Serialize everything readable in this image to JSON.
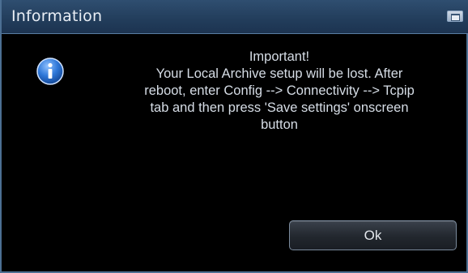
{
  "dialog": {
    "title": "Information",
    "icon": "info-icon",
    "message_lines": [
      "Important!",
      "Your Local Archive setup will be lost. After",
      "reboot, enter Config --> Connectivity --> Tcpip",
      "tab and then press 'Save settings' onscreen",
      "button"
    ],
    "ok_label": "Ok"
  },
  "colors": {
    "titlebar": "#223d5b",
    "background": "#000000",
    "text": "#d6dde6",
    "icon_blue": "#2f78d8"
  }
}
